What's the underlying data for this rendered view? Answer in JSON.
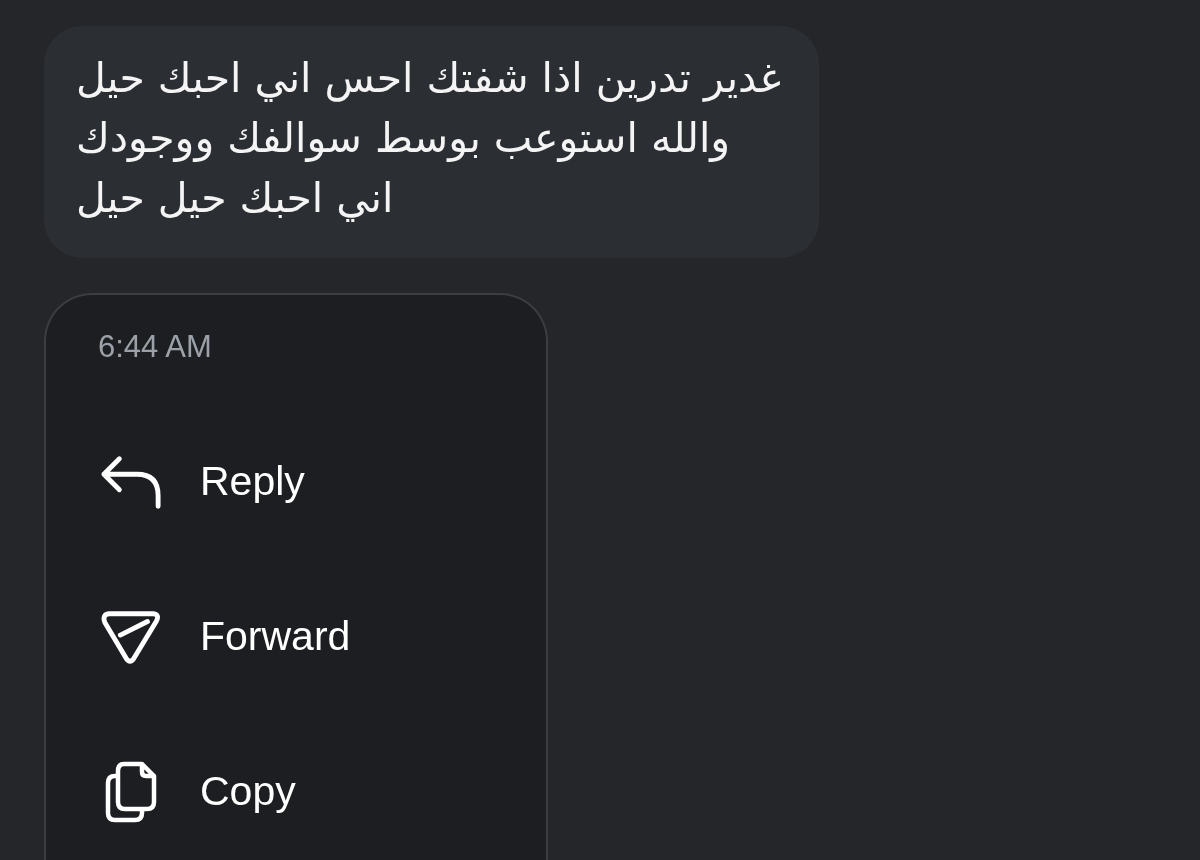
{
  "message": {
    "text": "غدير تدرين اذا شفتك احس اني احبك حيل\nوالله استوعب بوسط سوالفك ووجودك\nاني احبك حيل حيل"
  },
  "context_menu": {
    "time": "6:44 AM",
    "items": [
      {
        "label": "Reply"
      },
      {
        "label": "Forward"
      },
      {
        "label": "Copy"
      }
    ]
  }
}
